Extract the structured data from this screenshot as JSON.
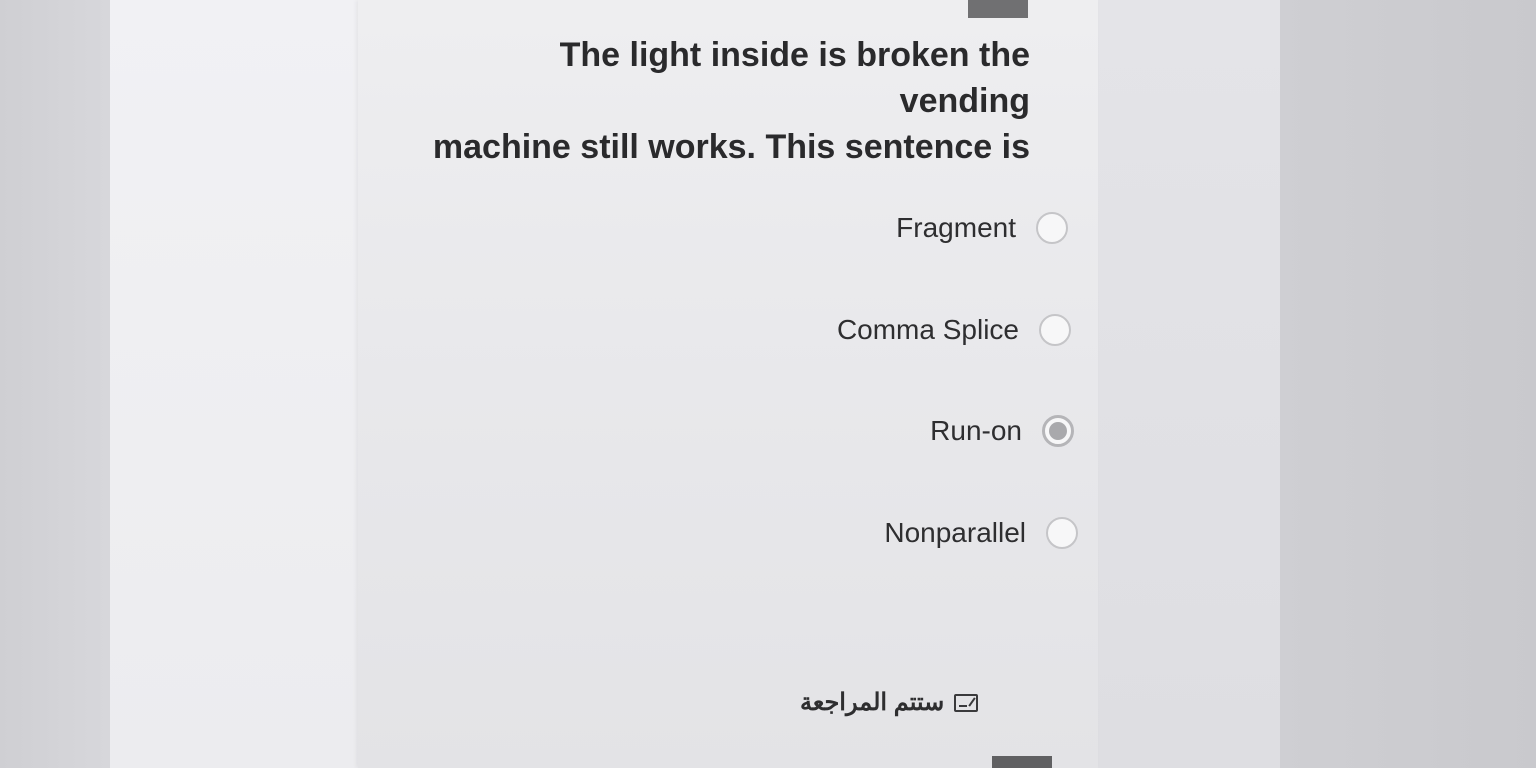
{
  "question": {
    "line1": "The light inside is broken the vending",
    "line2": "machine still works. This sentence is"
  },
  "options": [
    {
      "label": "Fragment",
      "selected": false
    },
    {
      "label": "Comma Splice",
      "selected": false
    },
    {
      "label": "Run-on",
      "selected": true
    },
    {
      "label": "Nonparallel",
      "selected": false
    }
  ],
  "review": {
    "label": "ستتم المراجعة",
    "icon": "edit-note-icon"
  }
}
